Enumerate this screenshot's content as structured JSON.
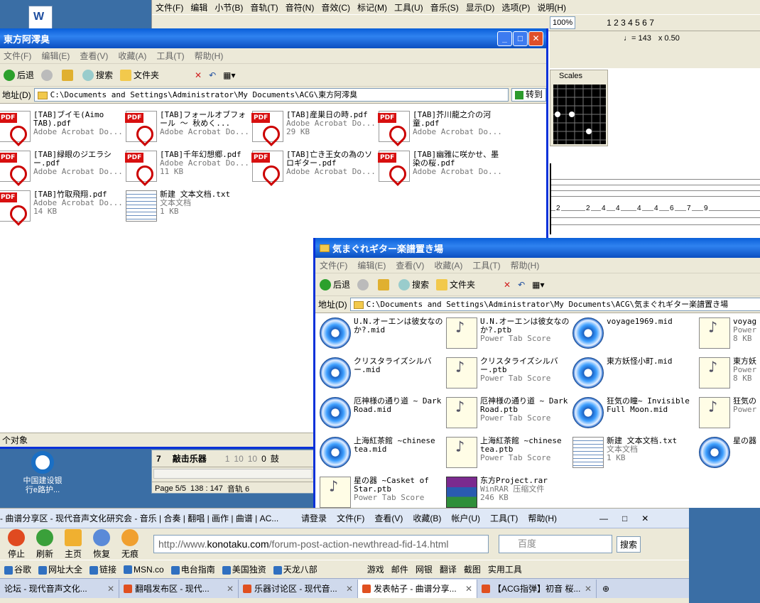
{
  "desktop": {
    "icons": [
      {
        "label": "中国建设银行e路护..."
      }
    ]
  },
  "music_app": {
    "menu": [
      "文件(F)",
      "编辑",
      "小节(B)",
      "音轨(T)",
      "音符(N)",
      "音效(C)",
      "标记(M)",
      "工具(U)",
      "音乐(S)",
      "显示(D)",
      "选项(P)",
      "说明(H)"
    ],
    "zoom": "100%",
    "page_nums": "1 2 3 4 5 6 7",
    "tempo": "♩= 143",
    "speed": "x 0.50",
    "scales_label": "Scales",
    "tab_numbers": [
      "2",
      "2",
      "4",
      "4",
      "4",
      "4",
      "6",
      "7",
      "9"
    ],
    "track_num": "7",
    "track_name": "敲击乐器",
    "track_vals": [
      "1",
      "10",
      "10",
      "0",
      "鼓"
    ],
    "page_status": "Page 5/5",
    "position": "138 : 147",
    "track_status": "音轨 6"
  },
  "window1": {
    "title": "東方阿澪臭",
    "menu": [
      "文件(F)",
      "编辑(E)",
      "查看(V)",
      "收藏(A)",
      "工具(T)",
      "帮助(H)"
    ],
    "toolbar": {
      "back": "后退",
      "search": "搜索",
      "folders": "文件夹"
    },
    "address_label": "地址(D)",
    "address": "C:\\Documents and Settings\\Administrator\\My Documents\\ACG\\東方阿澪臭",
    "go": "转到",
    "files": [
      {
        "name": "[TAB]ブイモ(Aimo TAB).pdf",
        "type": "Adobe Acrobat Do...",
        "size": "",
        "icon": "pdf"
      },
      {
        "name": "[TAB]フォールオブフォール ～ 秋めく...",
        "type": "Adobe Acrobat Do...",
        "size": "",
        "icon": "pdf"
      },
      {
        "name": "[TAB]産巣日の時.pdf",
        "type": "Adobe Acrobat Do...",
        "size": "29 KB",
        "icon": "pdf"
      },
      {
        "name": "[TAB]芥川龍之介の河童.pdf",
        "type": "Adobe Acrobat Do...",
        "size": "",
        "icon": "pdf"
      },
      {
        "name": "[TAB]緑眼のジエラシー.pdf",
        "type": "Adobe Acrobat Do...",
        "size": "",
        "icon": "pdf"
      },
      {
        "name": "[TAB]千年幻想郷.pdf",
        "type": "Adobe Acrobat Do...",
        "size": "11 KB",
        "icon": "pdf"
      },
      {
        "name": "[TAB]亡き王女の為のソロギター.pdf",
        "type": "Adobe Acrobat Do...",
        "size": "",
        "icon": "pdf"
      },
      {
        "name": "[TAB]幽雅に咲かせ、墨染の桜.pdf",
        "type": "Adobe Acrobat Do...",
        "size": "",
        "icon": "pdf"
      },
      {
        "name": "[TAB]竹取飛翔.pdf",
        "type": "Adobe Acrobat Do...",
        "size": "14 KB",
        "icon": "pdf"
      },
      {
        "name": "新建 文本文档.txt",
        "type": "文本文档",
        "size": "1 KB",
        "icon": "txt"
      }
    ],
    "status": "个对象"
  },
  "window2": {
    "title": "気まぐれギター楽譜置き場",
    "menu": [
      "文件(F)",
      "编辑(E)",
      "查看(V)",
      "收藏(A)",
      "工具(T)",
      "帮助(H)"
    ],
    "toolbar": {
      "back": "后退",
      "search": "搜索",
      "folders": "文件夹"
    },
    "address_label": "地址(D)",
    "address": "C:\\Documents and Settings\\Administrator\\My Documents\\ACG\\気まぐれギター楽譜置き場",
    "files": [
      {
        "name": "U.N.オーエンは彼女なのか?.mid",
        "type": "",
        "size": "",
        "icon": "mid"
      },
      {
        "name": "U.N.オーエンは彼女なのか?.ptb",
        "type": "Power Tab Score",
        "size": "",
        "icon": "ptb"
      },
      {
        "name": "voyage1969.mid",
        "type": "",
        "size": "",
        "icon": "mid"
      },
      {
        "name": "voyag",
        "type": "Power",
        "size": "8 KB",
        "icon": "ptb"
      },
      {
        "name": "クリスタライズシルバー.mid",
        "type": "",
        "size": "",
        "icon": "mid"
      },
      {
        "name": "クリスタライズシルバー.ptb",
        "type": "Power Tab Score",
        "size": "",
        "icon": "ptb"
      },
      {
        "name": "東方妖怪小町.mid",
        "type": "",
        "size": "",
        "icon": "mid"
      },
      {
        "name": "東方妖",
        "type": "Power",
        "size": "8 KB",
        "icon": "ptb"
      },
      {
        "name": "厄神様の通り道 ~ Dark Road.mid",
        "type": "",
        "size": "",
        "icon": "mid"
      },
      {
        "name": "厄神様の通り道 ~ Dark Road.ptb",
        "type": "Power Tab Score",
        "size": "",
        "icon": "ptb"
      },
      {
        "name": "狂気の瞳~ Invisible Full Moon.mid",
        "type": "",
        "size": "",
        "icon": "mid"
      },
      {
        "name": "狂気の Full M",
        "type": "Power",
        "size": "",
        "icon": "ptb"
      },
      {
        "name": "上海紅茶館 ~chinese tea.mid",
        "type": "",
        "size": "",
        "icon": "mid"
      },
      {
        "name": "上海紅茶館 ~chinese tea.ptb",
        "type": "Power Tab Score",
        "size": "",
        "icon": "ptb"
      },
      {
        "name": "新建 文本文档.txt",
        "type": "文本文档",
        "size": "1 KB",
        "icon": "txt"
      },
      {
        "name": "星の器 Star.",
        "type": "",
        "size": "",
        "icon": "mid"
      },
      {
        "name": "星の器 ~Casket of Star.ptb",
        "type": "Power Tab Score",
        "size": "",
        "icon": "ptb"
      },
      {
        "name": "东方Project.rar",
        "type": "WinRAR 压缩文件",
        "size": "246 KB",
        "icon": "rar"
      }
    ]
  },
  "browser": {
    "title": "- 曲谱分享区 - 现代音声文化研究会 - 音乐 | 合奏 | 翻唱 | 画作 | 曲谱 | AC...",
    "login": "请登录",
    "menu": [
      "文件(F)",
      "查看(V)",
      "收藏(B)",
      "帐户(U)",
      "工具(T)",
      "帮助(H)"
    ],
    "nav": [
      "停止",
      "刷新",
      "主页",
      "恢复",
      "无痕"
    ],
    "url_prefix": "http://www.",
    "url_host": "konotaku.com",
    "url_path": "/forum-post-action-newthread-fid-14.html",
    "search_placeholder": "百度",
    "search_btn": "搜索",
    "bookmarks": [
      "谷歌",
      "网址大全",
      "链接",
      "MSN.co",
      "电台指南",
      "美国独资",
      "天龙八部"
    ],
    "tools": [
      "游戏",
      "邮件",
      "网银",
      "翻译",
      "截图",
      "实用工具"
    ],
    "tabs": [
      {
        "label": "论坛 - 现代音声文化..."
      },
      {
        "label": "翻唱发布区 - 现代..."
      },
      {
        "label": "乐器讨论区 - 现代音..."
      },
      {
        "label": "发表帖子 - 曲谱分享..."
      },
      {
        "label": "【ACG指弹】初音 桜..."
      }
    ]
  }
}
